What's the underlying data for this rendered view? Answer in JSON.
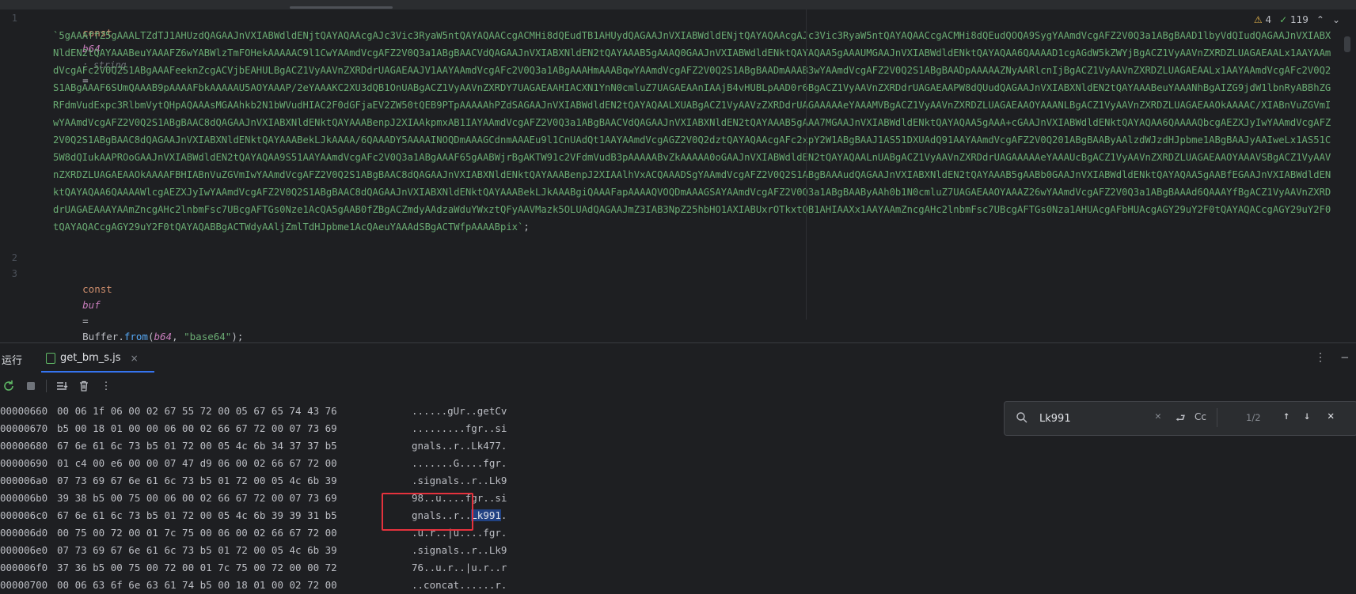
{
  "editor": {
    "line_numbers": [
      "1",
      "2",
      "3"
    ],
    "line1": {
      "keyword": "const",
      "var": "b64",
      "type_hint": ": string",
      "op": "="
    },
    "b64_value": "5gAAAffZ5gAAALTZdTJ1AHUzdQAGAAJnVXIABWdldENjtQAYAQAAcgAJc3Vic3RyaW5ntQAYAQAACcgACMHi8dQEudTB1AHUydQAGAAJnVXIABWdldENjtQAYAQAAcgAJc3Vic3RyaW5ntQAYAQAACcgACMHi8dQEudQOQA9SygYAAmdVcgAFZ2V0Q3a1ABgBAAD1lbyVdQIudQAGAAJnVXIABXNldEN2tQAYAAABeuYAAAFZ6wYABWlzTmFOHekAAAAAC9l1CwYAAmdVcgAFZ2V0Q3a1ABgBAACVdQAGAAJnVXIABXNldEN2tQAYAAAB5gAAAQ0GAAJnVXIABWdldENktQAYAQAA5gAAAUMGAAJnVXIABWdldENktQAYAQAA6QAAAAD1cgAGdW5kZWYjBgACZ1VyAAVnZXRDZLUAGAEAALx1AAYAAmdVcgAFc2V0Q2S1ABgAAAFeeknZcgACVjbEAHULBgACZ1VyAAVnZXRDdrUAGAEAAJV1AAYAAmdVcgAFc2V0Q3a1ABgAAAHmAAABqwYAAmdVcgAFZ2V0Q2S1ABgBAADmAAAB3wYAAmdVcgAFZ2V0Q2S1ABgBAADpAAAAAZNyAARlcnIjBgACZ1VyAAVnZXRDZLUAGAEAALx1AAYAAmdVcgAFc2V0Q2S1ABgAAAF6SUmQAAAB9pAAAAFbkAAAAAU5AOYAAAP/2eYAAAKC2XU3dQB1OnUABgACZ1VyAAVnZXRDY7UAGAEAAHIACXN1YnN0cmluZ7UAGAEAAnIAAjB4vHUBLpAAD0r6BgACZ1VyAAVnZXRDdrUAGAEAAPW8dQUudQAGAAJnVXIABXNldEN2tQAYAAABeuYAAANhBgAIZG9jdW1lbnRyABBhZGRFdmVudExpc3RlbmVytQHpAQAAAsMGAAhkb2N1bWVudHIAC2F0dGFjaEV2ZW50tQEB9PTpAAAAAhPZdSAGAAJnVXIABWdldEN2tQAYAQAALXUABgACZ1VyAAVzZXRDdrUAGAAAAAeYAAAMVBgACZ1VyAAVnZXRDZLUAGAEAAOYAAANLBgACZ1VyAAVnZXRDZLUAGAEAAOkAAAAC/XIABnVuZGVmIwYAAmdVcgAFZ2V0Q2S1ABgBAAC8dQAGAAJnVXIABXNldENktQAYAAABenpJ2XIAAkpmxAB1IAYAAmdVcgAFZ2V0Q3a1ABgBAACVdQAGAAJnVXIABXNldEN2tQAYAAAB5gAAA7MGAAJnVXIABWdldENktQAYAQAA5gAAA+cGAAJnVXIABWdldENktQAYAQAA6QAAAAQbcgAEZXJyIwYAAmdVcgAFZ2V0Q2S1ABgBAAC8dQAGAAJnVXIABXNldENktQAYAAABekLJkAAAA/6QAAADY5AAAAINOQDmAAAGCdnmAAAEu9l1CnUAdQt1AAYAAmdVcgAGZ2V0Q2dztQAYAQAAcgAFc2xpY2W1ABgBAAJ1AS51DXUAdQ91AAYAAmdVcgAFZ2V0Q201ABgBAAByAAlzdWJzdHJpbme1ABgBAAJyAAIweLx1AS51C5W8dQIukAAPROoGAAJnVXIABWdldEN2tQAYAQAA9S51AAYAAmdVcgAFc2V0Q3a1ABgAAAF65gAABWjrBgAKTW91c2VFdmVudB3pAAAAABvZkAAAAA0oGAAJnVXIABWdldEN2tQAYAQAALnUABgACZ1VyAAVnZXRDdrUAGAAAAAeYAAAUcBgACZ1VyAAVnZXRDZLUAGAEAAOYAAAVSBgACZ1VyAAVnZXRDZLUAGAEAAOkAAAAFBHIABnVuZGVmIwYAAmdVcgAFZ2V0Q2S1ABgBAAC8dQAGAAJnVXIABXNldENktQAYAAABenpJ2XIAAlhVxACQAAADSgYAAmdVcgAFZ2V0Q2S1ABgBAAAudQAGAAJnVXIABXNldEN2tQAYAAAB5gAABb0GAAJnVXIABWdldENktQAYAQAA5gAABfEGAAJnVXIABWdldENktQAYAQAA6QAAAAWlcgAEZXJyIwYAAmdVcgAFZ2V0Q2S1ABgBAAC8dQAGAAJnVXIABXNldENktQAYAAABekLJkAAABgiQAAAFapAAAAQVOQDmAAAGSAYAAmdVcgAFZ2V0Q3a1ABgBAAByAAh0b1N0cmluZ7UAGAEAAOYAAAZ26wYAAmdVcgAFZ2V0Q3a1ABgBAAAd6QAAAYfBgACZ1VyAAVnZXRDdrUAGAEAAAYAAmZncgAHc2lnbmFsc7UBcgAFTGs0Nze1AcQA5gAAB0fZBgACZmdyAAdzaWduYWxztQFyAAVMazk5OLUAdQAGAAJmZ3IAB3NpZ25hbHO1AXIABUxrOTkxtQB1AHIAAXx1AAYAAmZncgAHc2lnbmFsc7UBcgAFTGs0Nza1AHUAcgAFbHUAcgAGY29uY2F0tQAYAQACcgAGY29uY2F0tQAYAQACcgAGY29uY2F0tQAYAQABBgACTWdyAAljZmlTdHJpbme1AcQAeuYAAAdSBgACTWfpAAAABpix",
    "line1_tail": ";",
    "line3": {
      "keyword": "const",
      "var": "buf",
      "op": "=",
      "obj": "Buffer",
      "dot": ".",
      "method": "from",
      "args_open": "(",
      "arg1": "b64",
      "comma": ", ",
      "arg2": "\"base64\"",
      "args_close": ");"
    },
    "inspections": {
      "warnings": "4",
      "ok": "119"
    }
  },
  "run_panel": {
    "title": "运行",
    "tab_label": "get_bm_s.js",
    "close_glyph": "×",
    "menu_glyph": "⋮",
    "minimize_glyph": "—"
  },
  "console": {
    "rows": [
      {
        "offset": "00000660",
        "bytes": "00 06 1f 06 00 02 67 55 72 00 05 67 65 74 43 76",
        "ascii": "......gUr..getCv"
      },
      {
        "offset": "00000670",
        "bytes": "b5 00 18 01 00 00 06 00 02 66 67 72 00 07 73 69",
        "ascii": ".........fgr..si"
      },
      {
        "offset": "00000680",
        "bytes": "67 6e 61 6c 73 b5 01 72 00 05 4c 6b 34 37 37 b5",
        "ascii": "gnals..r..Lk477."
      },
      {
        "offset": "00000690",
        "bytes": "01 c4 00 e6 00 00 07 47 d9 06 00 02 66 67 72 00",
        "ascii": ".......G....fgr."
      },
      {
        "offset": "000006a0",
        "bytes": "07 73 69 67 6e 61 6c 73 b5 01 72 00 05 4c 6b 39",
        "ascii": ".signals..r..Lk9"
      },
      {
        "offset": "000006b0",
        "bytes": "39 38 b5 00 75 00 06 00 02 66 67 72 00 07 73 69",
        "ascii": "98..u....fgr..si"
      },
      {
        "offset": "000006c0",
        "bytes": "67 6e 61 6c 73 b5 01 72 00 05 4c 6b 39 39 31 b5",
        "ascii_pre": "gnals..r..",
        "ascii_hit": "Lk991",
        "ascii_post": "."
      },
      {
        "offset": "000006d0",
        "bytes": "00 75 00 72 00 01 7c 75 00 06 00 02 66 67 72 00",
        "ascii": ".u.r..|u....fgr."
      },
      {
        "offset": "000006e0",
        "bytes": "07 73 69 67 6e 61 6c 73 b5 01 72 00 05 4c 6b 39",
        "ascii": ".signals..r..Lk9"
      },
      {
        "offset": "000006f0",
        "bytes": "37 36 b5 00 75 00 72 00 01 7c 75 00 72 00 00 72",
        "ascii": "76..u.r..|u.r..r"
      },
      {
        "offset": "00000700",
        "bytes": "00 06 63 6f 6e 63 61 74 b5 00 18 01 00 02 72 00",
        "ascii": "..concat......r."
      }
    ]
  },
  "search": {
    "value": "Lk991",
    "case_label": "Cc",
    "count": "1/2"
  },
  "colors": {
    "background": "#1e1f22",
    "string_green": "#6aab73",
    "keyword_orange": "#cf8e6d",
    "highlight_box": "#e5323d",
    "search_hit": "#214283",
    "tab_underline": "#3574f0"
  }
}
